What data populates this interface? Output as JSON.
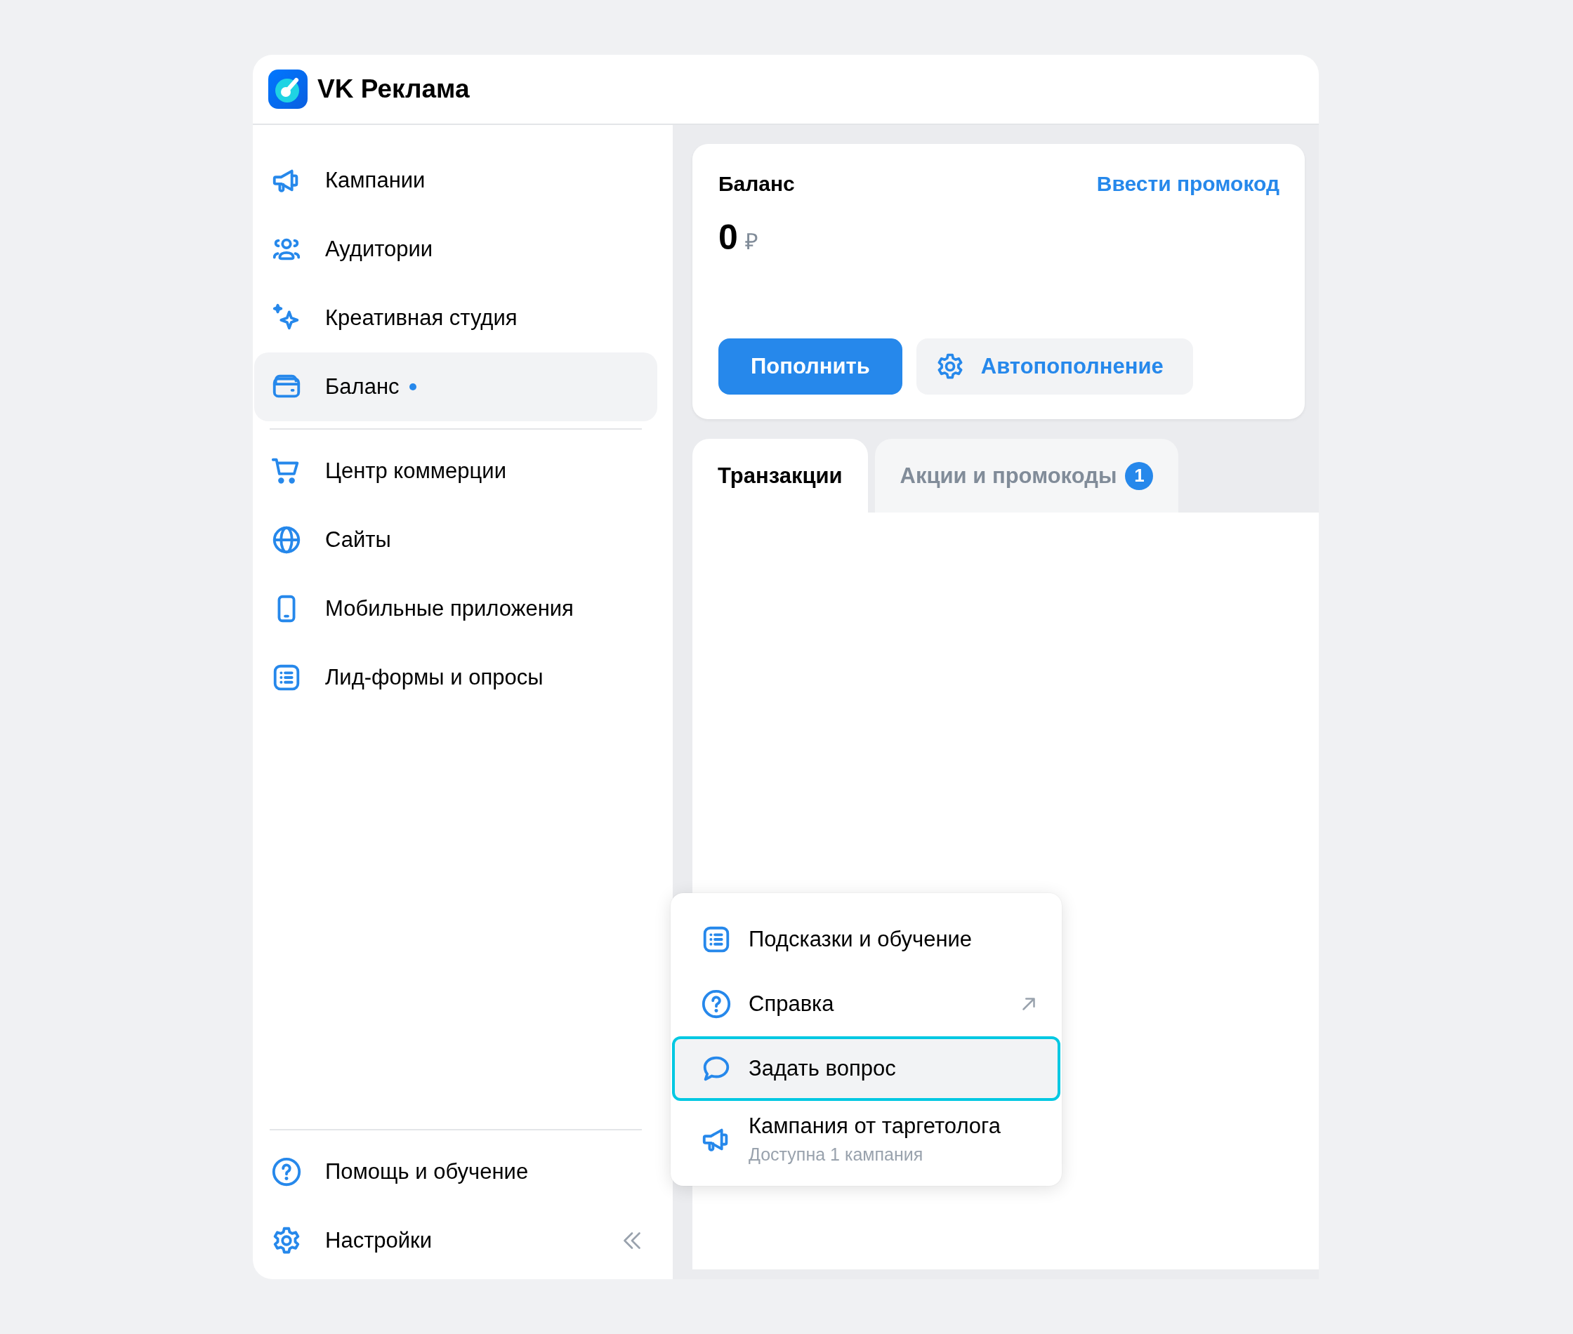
{
  "header": {
    "title": "VK Реклама"
  },
  "sidebar": {
    "main_items": [
      {
        "label": "Кампании",
        "selected": false,
        "unread_dot": false
      },
      {
        "label": "Аудитории",
        "selected": false,
        "unread_dot": false
      },
      {
        "label": "Креативная студия",
        "selected": false,
        "unread_dot": false
      },
      {
        "label": "Баланс",
        "selected": true,
        "unread_dot": true
      }
    ],
    "commerce_items": [
      {
        "label": "Центр коммерции",
        "selected": false,
        "unread_dot": false
      },
      {
        "label": "Сайты",
        "selected": false,
        "unread_dot": false
      },
      {
        "label": "Мобильные приложения",
        "selected": false,
        "unread_dot": false
      },
      {
        "label": "Лид-формы и опросы",
        "selected": false,
        "unread_dot": false
      }
    ],
    "footer_items": [
      {
        "label": "Помощь и обучение",
        "selected": false,
        "unread_dot": false
      },
      {
        "label": "Настройки",
        "selected": false,
        "unread_dot": false
      }
    ]
  },
  "balance_card": {
    "title": "Баланс",
    "promo_link": "Ввести промокод",
    "amount": "0",
    "currency": "₽",
    "buttons": [
      {
        "label": "Пополнить",
        "kind": "primary"
      },
      {
        "label": "Автопополнение",
        "kind": "secondary"
      }
    ]
  },
  "tabs": [
    {
      "label": "Транзакции",
      "selected": true
    },
    {
      "label": "Акции и промокоды",
      "selected": false,
      "badge": "1"
    }
  ],
  "help_menu": {
    "items": [
      {
        "label": "Подсказки и обучение",
        "selected": false,
        "external": false
      },
      {
        "label": "Справка",
        "selected": false,
        "external": true
      },
      {
        "label": "Задать вопрос",
        "selected": true,
        "external": false
      },
      {
        "label": "Кампания от таргетолога",
        "subtitle": "Доступна 1 кампания",
        "selected": false,
        "external": false
      }
    ]
  }
}
